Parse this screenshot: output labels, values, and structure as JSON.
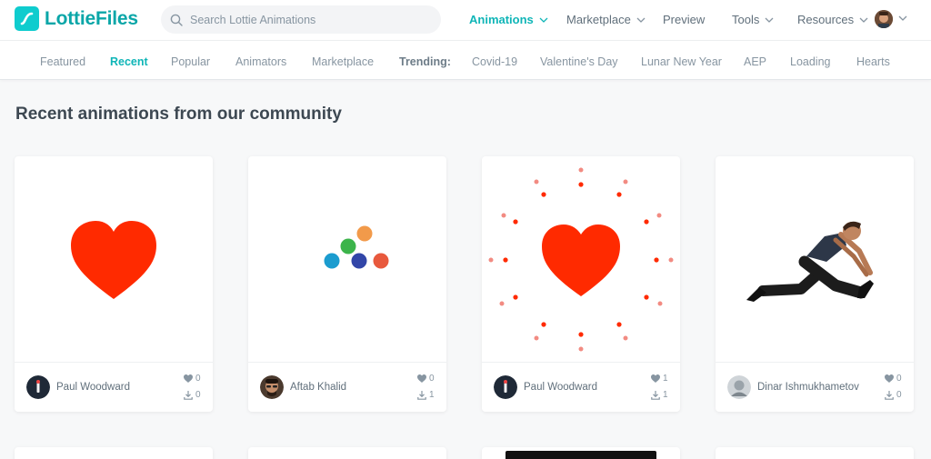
{
  "brand": {
    "name": "LottieFiles",
    "color": "#0fccce"
  },
  "search": {
    "placeholder": "Search Lottie Animations",
    "value": ""
  },
  "topnav": {
    "items": [
      {
        "label": "Animations",
        "has_dropdown": true,
        "active": true
      },
      {
        "label": "Marketplace",
        "has_dropdown": true,
        "active": false
      },
      {
        "label": "Preview",
        "has_dropdown": false,
        "active": false
      },
      {
        "label": "Tools",
        "has_dropdown": true,
        "active": false
      },
      {
        "label": "Resources",
        "has_dropdown": true,
        "active": false
      }
    ]
  },
  "subnav": {
    "items": [
      "Featured",
      "Recent",
      "Popular",
      "Animators",
      "Marketplace"
    ],
    "active": "Recent",
    "trending_label": "Trending:",
    "trending": [
      "Covid-19",
      "Valentine's Day",
      "Lunar New Year",
      "AEP",
      "Loading",
      "Hearts"
    ]
  },
  "page": {
    "title": "Recent animations from our community"
  },
  "cards": [
    {
      "author": "Paul Woodward",
      "likes": "0",
      "downloads": "0",
      "preview": "heart"
    },
    {
      "author": "Aftab Khalid",
      "likes": "0",
      "downloads": "1",
      "preview": "dots"
    },
    {
      "author": "Paul Woodward",
      "likes": "1",
      "downloads": "1",
      "preview": "heart-burst"
    },
    {
      "author": "Dinar Ishmukhametov",
      "likes": "0",
      "downloads": "0",
      "preview": "stretching-person"
    }
  ],
  "colors": {
    "accent": "#0fb5b7",
    "heart": "#ff2a00"
  }
}
